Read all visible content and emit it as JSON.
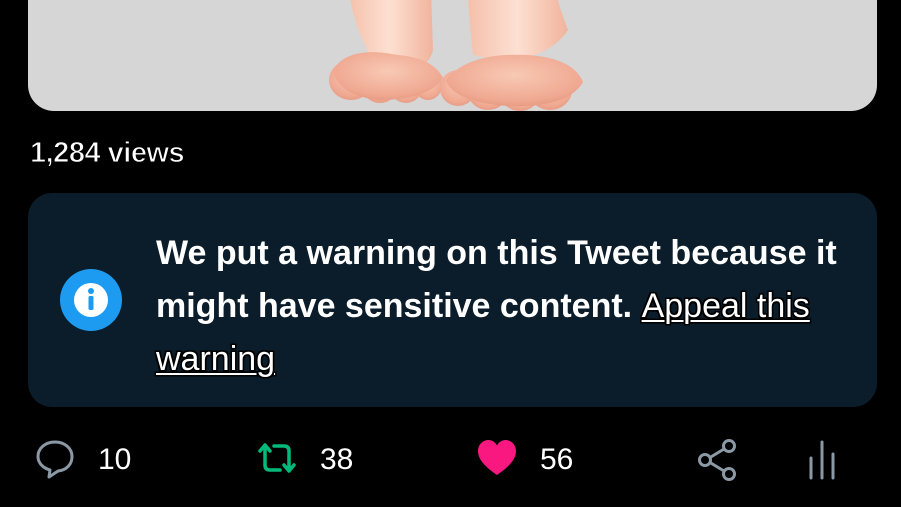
{
  "tweet": {
    "views_text": "1,284 views",
    "warning": {
      "message": "We put a warning on this Tweet because it might have sensitive content.",
      "appeal_link": "Appeal this warning",
      "icon": "info-icon"
    },
    "actions": {
      "reply": {
        "icon": "reply-icon",
        "count": "10"
      },
      "retweet": {
        "icon": "retweet-icon",
        "count": "38",
        "color": "#00ba7c"
      },
      "like": {
        "icon": "heart-icon",
        "count": "56",
        "color": "#f91880"
      },
      "share": {
        "icon": "share-icon"
      },
      "analytics": {
        "icon": "analytics-icon"
      }
    }
  },
  "colors": {
    "background": "#000000",
    "warning_card": "#0b1d2a",
    "info_blue": "#1d9bf0",
    "media_bg": "#d6d6d6"
  }
}
